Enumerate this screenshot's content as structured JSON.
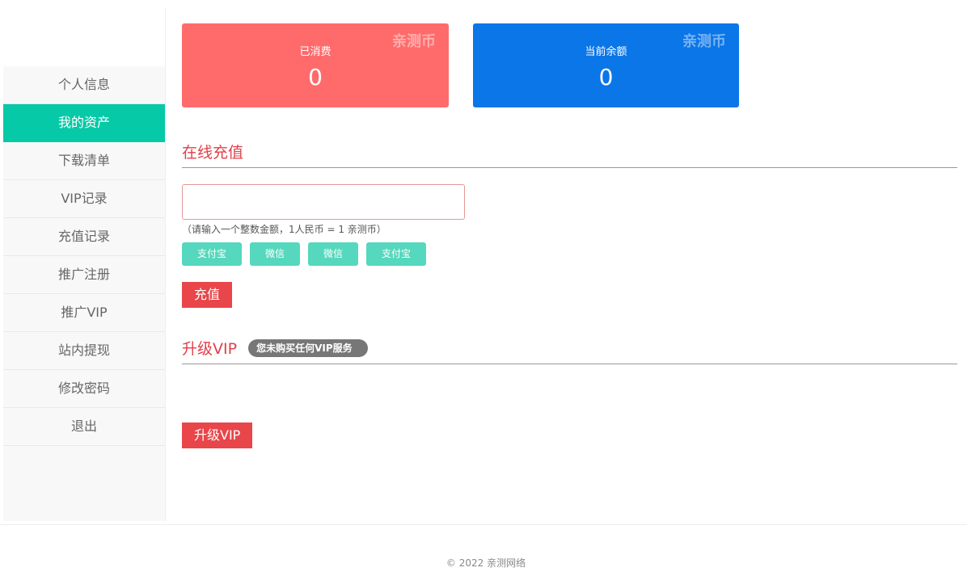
{
  "sidebar": {
    "items": [
      {
        "label": "个人信息",
        "active": false
      },
      {
        "label": "我的资产",
        "active": true
      },
      {
        "label": "下载清单",
        "active": false
      },
      {
        "label": "VIP记录",
        "active": false
      },
      {
        "label": "充值记录",
        "active": false
      },
      {
        "label": "推广注册",
        "active": false
      },
      {
        "label": "推广VIP",
        "active": false
      },
      {
        "label": "站内提现",
        "active": false
      },
      {
        "label": "修改密码",
        "active": false
      },
      {
        "label": "退出",
        "active": false
      }
    ]
  },
  "cards": {
    "spent": {
      "tag": "亲测币",
      "label": "已消费",
      "value": "0",
      "color": "#ff6b6b"
    },
    "balance": {
      "tag": "亲测币",
      "label": "当前余额",
      "value": "0",
      "color": "#0a76e8"
    }
  },
  "recharge": {
    "title": "在线充值",
    "input_value": "",
    "input_placeholder": "",
    "hint": "（请输入一个整数金额，1人民币 = 1 亲测币）",
    "pay_methods": [
      "支付宝",
      "微信",
      "微信",
      "支付宝"
    ],
    "submit_label": "充值"
  },
  "vip": {
    "title": "升级VIP",
    "badge": "您未购买任何VIP服务",
    "upgrade_label": "升级VIP"
  },
  "footer": {
    "copyright": "© 2022 亲测网络"
  },
  "colors": {
    "accent": "#05c9a7",
    "danger": "#e8464a",
    "pay_button": "#55d8bd"
  }
}
